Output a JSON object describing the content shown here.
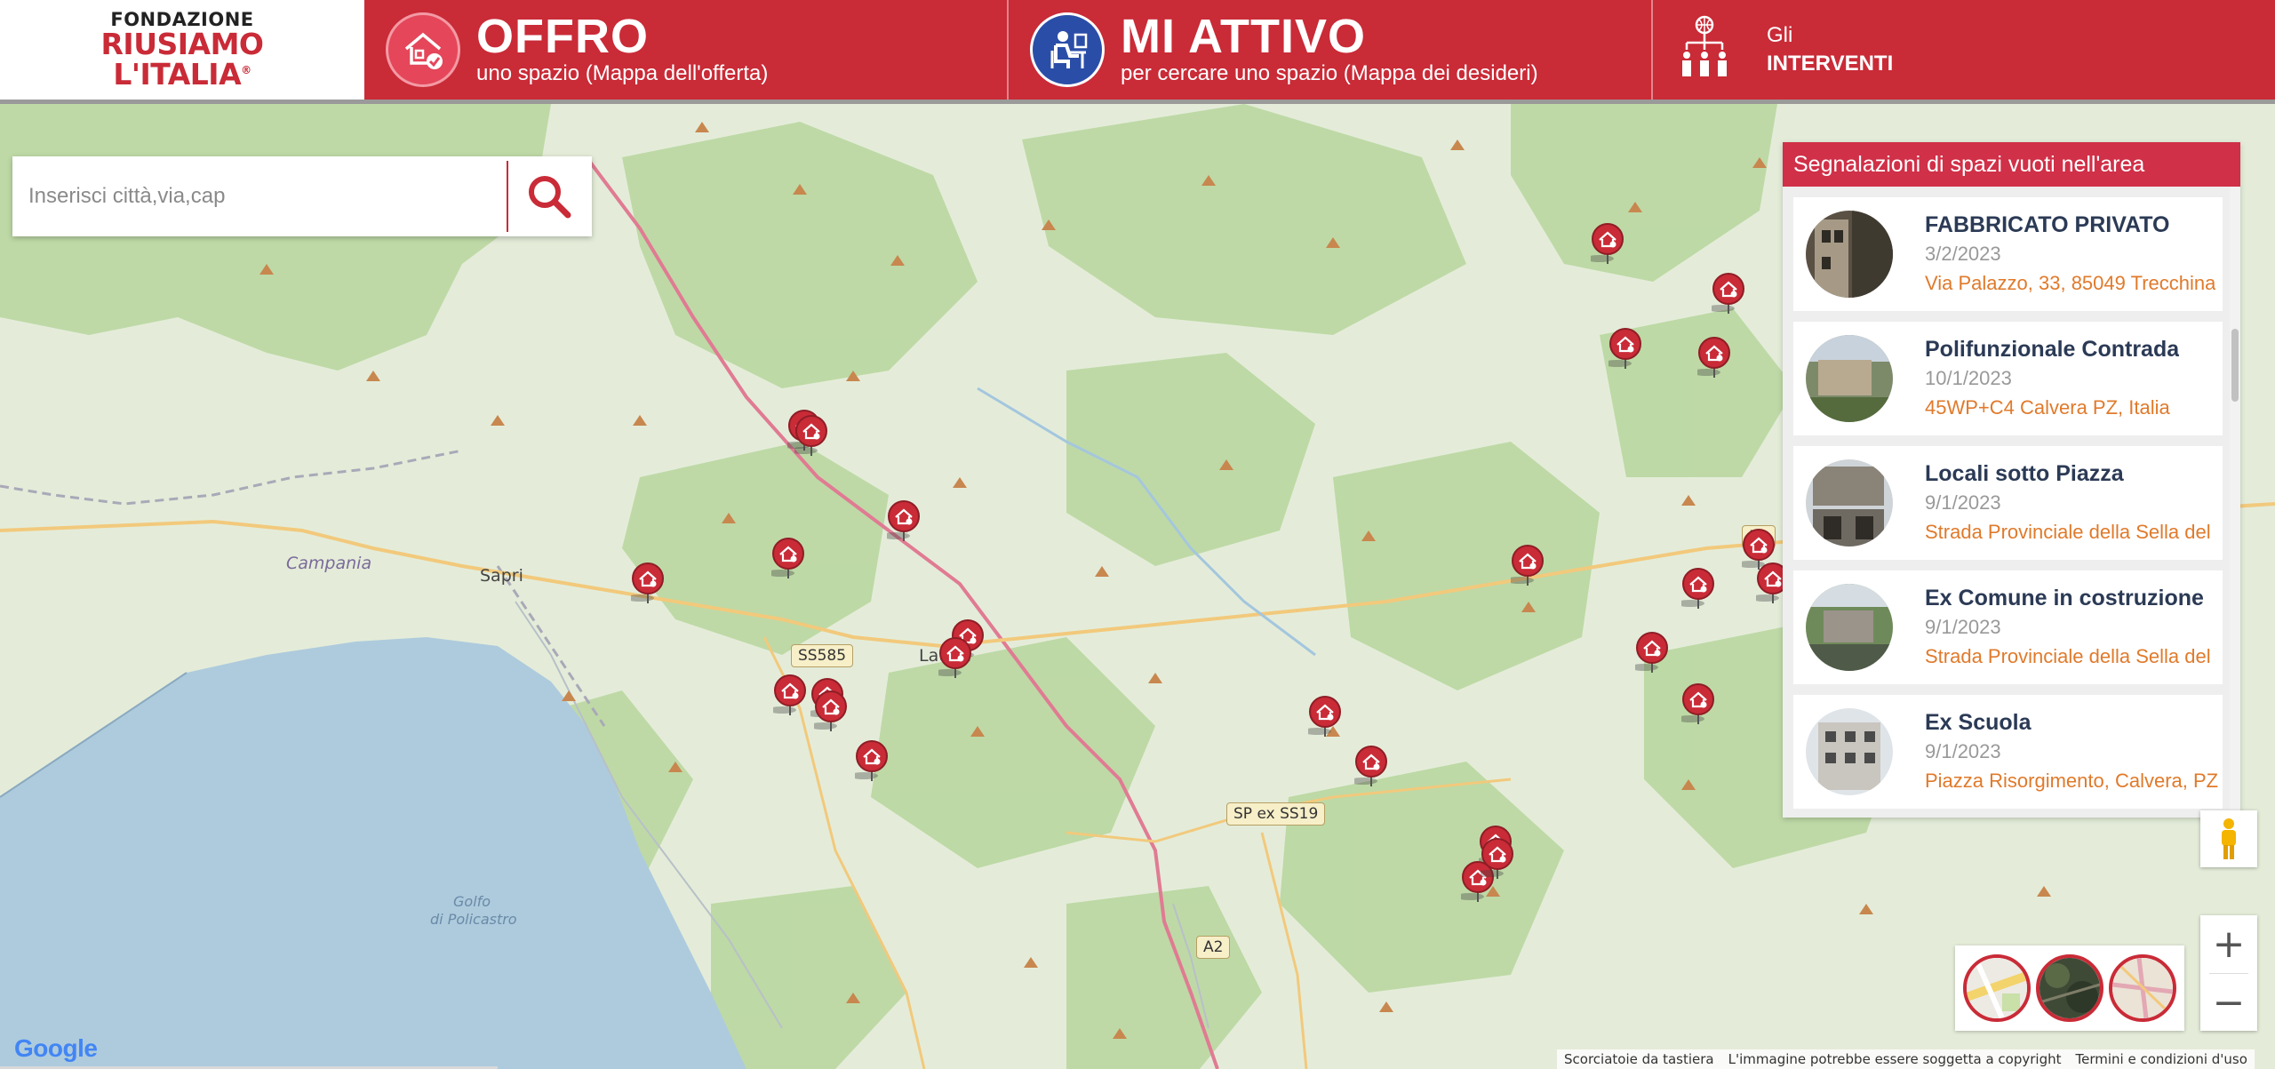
{
  "logo": {
    "line1": "FONDAZIONE",
    "line2": "RIUSIAMO",
    "line3": "L'ITALIA",
    "registered": "®"
  },
  "nav": {
    "offro": {
      "title": "OFFRO",
      "subtitle": "uno spazio (Mappa dell'offerta)",
      "icon": "house-check-icon"
    },
    "attivo": {
      "title": "MI ATTIVO",
      "subtitle": "per cercare uno spazio (Mappa dei desideri)",
      "icon": "person-desk-icon"
    },
    "interventi": {
      "small": "Gli",
      "big": "INTERVENTI",
      "icon": "people-network-icon"
    }
  },
  "search": {
    "placeholder": "Inserisci città,via,cap",
    "icon": "search-icon"
  },
  "panel": {
    "title": "Segnalazioni di spazi vuoti nell'area",
    "items": [
      {
        "title": "FABBRICATO PRIVATO",
        "date": "3/2/2023",
        "address": "Via Palazzo, 33, 85049 Trecchina"
      },
      {
        "title": "Polifunzionale Contrada",
        "date": "10/1/2023",
        "address": "45WP+C4 Calvera PZ, Italia"
      },
      {
        "title": "Locali sotto Piazza",
        "date": "9/1/2023",
        "address": "Strada Provinciale della Sella del"
      },
      {
        "title": "Ex Comune in costruzione",
        "date": "9/1/2023",
        "address": "Strada Provinciale della Sella del"
      },
      {
        "title": "Ex Scuola",
        "date": "9/1/2023",
        "address": "Piazza Risorgimento, Calvera, PZ"
      }
    ]
  },
  "map": {
    "places": {
      "sapri": "Sapri",
      "lauria": "Lauria",
      "campania": "Campania",
      "golfo1": "Golfo",
      "golfo2": "di Policastro"
    },
    "roads": {
      "ss585": "SS585",
      "spss19": "SP ex SS19",
      "a2": "A2",
      "r53": "53"
    },
    "colors": {
      "land": "#e4ecd9",
      "forest": "#b9d7a0",
      "sea": "#aecbdd",
      "road": "#e07b93",
      "marker": "#c92b37"
    }
  },
  "controls": {
    "zoom_in": "+",
    "zoom_out": "−"
  },
  "footer": {
    "google": "Google",
    "shortcuts": "Scorciatoie da tastiera",
    "copyright": "L'immagine potrebbe essere soggetta a copyright",
    "terms": "Termini e condizioni d'uso"
  }
}
